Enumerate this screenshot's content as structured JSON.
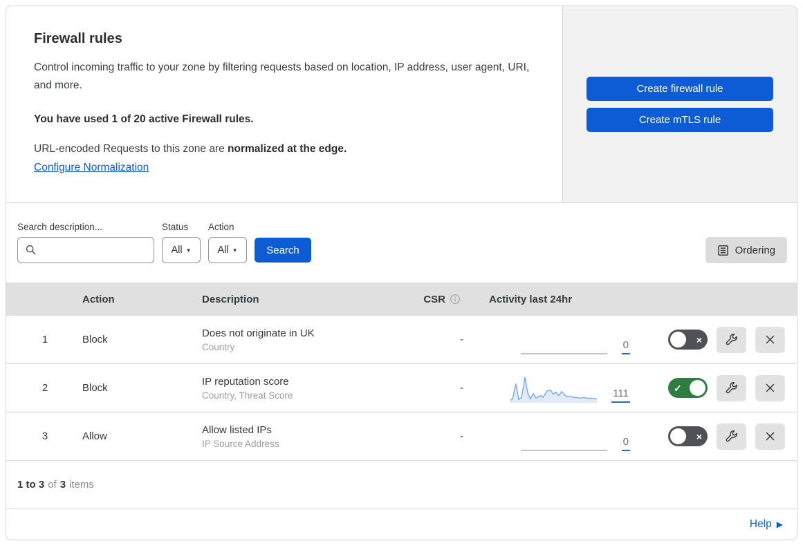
{
  "header": {
    "title": "Firewall rules",
    "description": "Control incoming traffic to your zone by filtering requests based on location, IP address, user agent, URI, and more.",
    "usage_note": "You have used 1 of 20 active Firewall rules.",
    "normalization_prefix": "URL-encoded Requests to this zone are ",
    "normalization_bold": "normalized at the edge.",
    "normalization_link": "Configure Normalization",
    "create_firewall_button": "Create firewall rule",
    "create_mtls_button": "Create mTLS rule"
  },
  "filters": {
    "search_label": "Search description...",
    "status_label": "Status",
    "status_value": "All",
    "action_label": "Action",
    "action_value": "All",
    "search_button": "Search",
    "ordering_button": "Ordering"
  },
  "table": {
    "headers": {
      "action": "Action",
      "description": "Description",
      "csr": "CSR",
      "activity": "Activity last 24hr"
    },
    "rows": [
      {
        "number": "1",
        "action": "Block",
        "description": "Does not originate in UK",
        "criteria": "Country",
        "csr": "-",
        "activity_count": "0",
        "enabled": false
      },
      {
        "number": "2",
        "action": "Block",
        "description": "IP reputation score",
        "criteria": "Country, Threat Score",
        "csr": "-",
        "activity_count": "111",
        "enabled": true
      },
      {
        "number": "3",
        "action": "Allow",
        "description": "Allow listed IPs",
        "criteria": "IP Source Address",
        "csr": "-",
        "activity_count": "0",
        "enabled": false
      }
    ]
  },
  "footer": {
    "range_text": "1 to 3",
    "of_text": "of",
    "total_text": "3",
    "items_text": "items",
    "help_link": "Help"
  },
  "icons": {
    "search": "magnifier",
    "info": "circled-i",
    "ordering": "document-lines",
    "wrench": "wrench",
    "close": "x-mark",
    "caret_down": "▼",
    "toggle_check": "✓",
    "toggle_x": "×",
    "help_arrow": "▶"
  },
  "colors": {
    "primary_blue": "#0b5cd5",
    "toggle_on_green": "#2e7d41",
    "toggle_off_gray": "#4f5156",
    "sparkline_blue": "#7fa8e6",
    "table_header_gray": "#e0e0e0",
    "panel_gray": "#f2f2f2"
  },
  "sparkline": {
    "type": "line",
    "period": "last 24hr",
    "total": 111,
    "values_relative": [
      4,
      6,
      29,
      5,
      8,
      39,
      15,
      6,
      14,
      7,
      9,
      11,
      8,
      18,
      19,
      13,
      16,
      11,
      17,
      12,
      9,
      10,
      8,
      8,
      7,
      8,
      7,
      7,
      6
    ],
    "line": "0,38 3,36 8,13 12,37 16,34 21,3 25,27 29,36 33,28 37,35 40,33 44,31 47,34 53,24 58,23 62,29 66,26 70,31 74,25 78,30 83,33 87,32 91,34 96,34 101,35 106,34 111,35 118,35 125,36",
    "fill": "0,38 3,36 8,13 12,37 16,34 21,3 25,27 29,36 33,28 37,35 40,33 44,31 47,34 53,24 58,23 62,29 66,26 70,31 74,25 78,30 83,33 87,32 91,34 96,34 101,35 106,34 111,35 118,35 125,36 125,42 0,42"
  }
}
